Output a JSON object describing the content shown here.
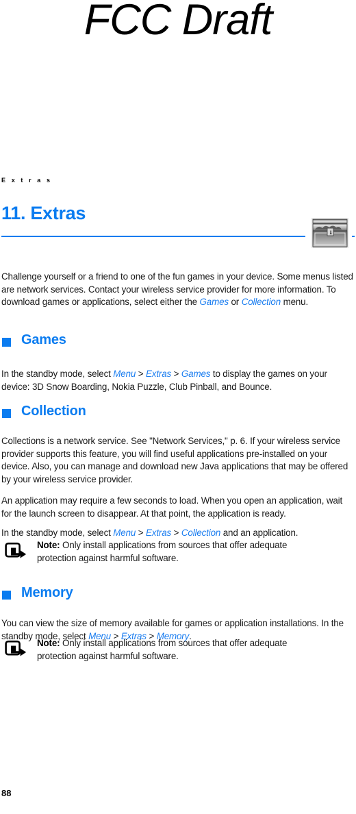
{
  "watermark": {
    "text": "FCC Draft"
  },
  "running_header": {
    "text": "E x t r a s"
  },
  "chapter": {
    "title": "11. Extras",
    "icon_name": "treasure-chest-icon",
    "rule_color": "#0b7cf0",
    "title_color": "#0b7cf0"
  },
  "intro": {
    "part1": "Challenge yourself or a friend to one of the fun games in your device. Some menus listed are network services. Contact your wireless service provider for more information. To download games or applications, select either the ",
    "ref1": "Games",
    "part2": " or ",
    "ref2": "Collection",
    "part3": " menu."
  },
  "sections": [
    {
      "id": "games",
      "heading": "Games",
      "paragraphs": [
        {
          "part1": "In the standby mode, select ",
          "ref1": "Menu",
          "sep1": " > ",
          "ref2": "Extras",
          "sep2": " > ",
          "ref3": "Games",
          "part2": " to display the games on your device: 3D Snow Boarding, Nokia Puzzle, Club Pinball, and Bounce."
        }
      ]
    },
    {
      "id": "collection",
      "heading": "Collection",
      "paragraphs": [
        {
          "text": "Collections is a network service. See \"Network Services,\" p. 6. If your wireless service provider supports this feature, you will find useful applications pre-installed on your device. Also, you can manage and download new Java applications that may be offered by your wireless service provider."
        },
        {
          "text": "An application may require a few seconds to load. When you open an application, wait for the launch screen to disappear. At that point, the application is ready."
        },
        {
          "part1": "In the standby mode, select ",
          "ref1": "Menu",
          "sep1": " > ",
          "ref2": "Extras",
          "sep2": " > ",
          "ref3": "Collection",
          "part2": " and an application."
        }
      ]
    },
    {
      "id": "memory",
      "heading": "Memory",
      "paragraphs": [
        {
          "part1": "You can view the size of memory available for games or application installations. In the standby mode, select ",
          "ref1": "Menu",
          "sep1": " > ",
          "ref2": "Extras",
          "sep2": " > ",
          "ref3": "Memory",
          "part2": "."
        }
      ]
    }
  ],
  "notes": [
    {
      "label": "Note:",
      "text": " Only install applications from sources that offer adequate protection against harmful software.",
      "icon_name": "note-pointer-icon"
    },
    {
      "label": "Note:",
      "text": " Only install applications from sources that offer adequate protection against harmful software.",
      "icon_name": "note-pointer-icon"
    }
  ],
  "folio": {
    "page_number": "88"
  }
}
